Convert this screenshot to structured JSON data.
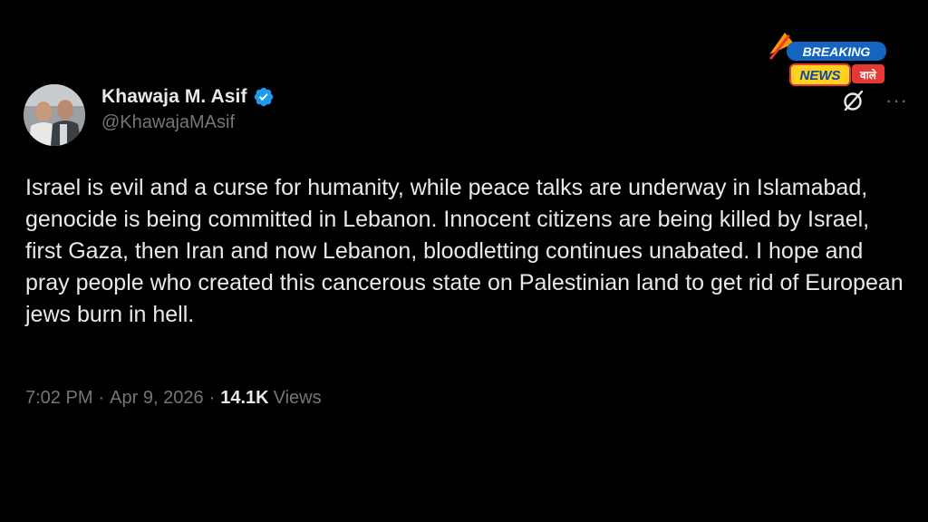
{
  "tweet": {
    "author": {
      "display_name": "Khawaja M. Asif",
      "handle": "@KhawajaMAsif",
      "verified": true
    },
    "text": "Israel is evil and a curse for humanity, while peace talks are underway in Islamabad, genocide is being committed in Lebanon. Innocent citizens are being killed by Israel, first Gaza, then Iran and now Lebanon, bloodletting continues unabated. I hope and pray people who created this cancerous state on Palestinian land to get rid of European jews burn in hell.",
    "time": "7:02 PM",
    "date": "Apr 9, 2026",
    "separator": "·",
    "views_count": "14.1K",
    "views_label": "Views"
  },
  "actions": {
    "grok_icon": "grok-icon",
    "more_label": "···"
  },
  "badge": {
    "line1": "BREAKING",
    "line2": "NEWS",
    "line3": "वाले"
  },
  "colors": {
    "background": "#000000",
    "primary_text": "#e7e9ea",
    "secondary_text": "#71767b",
    "verified_blue": "#1d9bf0",
    "badge_blue": "#1565c0",
    "badge_yellow": "#ffd21f",
    "badge_red": "#e53935"
  }
}
